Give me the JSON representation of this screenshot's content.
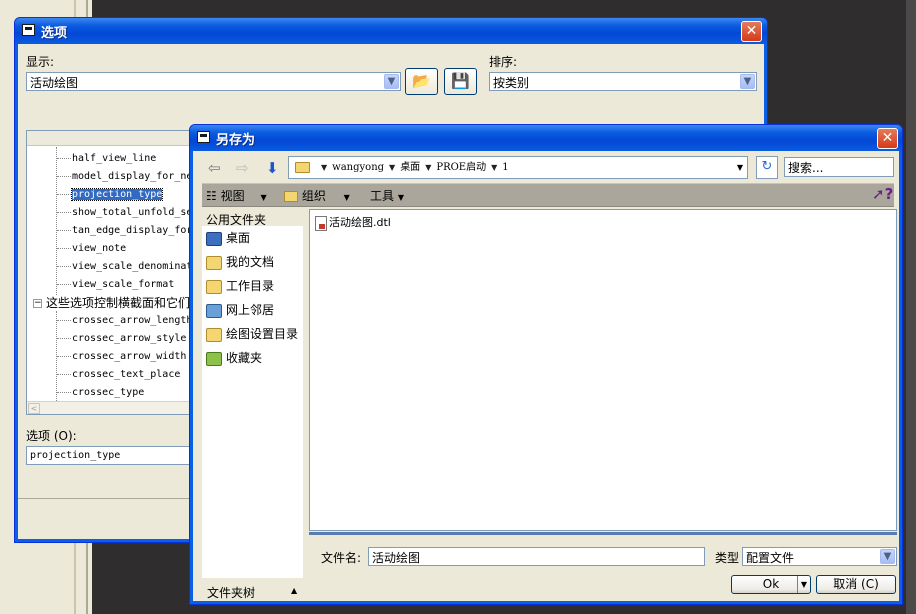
{
  "options_window": {
    "title": "选项",
    "close_glyph": "✕",
    "show_label": "显示:",
    "show_value": "活动绘图",
    "sort_label": "排序:",
    "sort_value": "按类别",
    "tree_items": [
      "half_view_line",
      "model_display_for_ne",
      "projection_type",
      "show_total_unfold_se",
      "tan_edge_display_for",
      "view_note",
      "view_scale_denominat",
      "view_scale_format"
    ],
    "selected_item": "projection_type",
    "group_label": "这些选项控制横截面和它们",
    "group_expander": "⊟",
    "group_items": [
      "crossec_arrow_length",
      "crossec_arrow_style",
      "crossec_arrow_width",
      "crossec_text_place",
      "crossec_type"
    ],
    "option_label": "选项 (O):",
    "option_value": "projection_type"
  },
  "save_window": {
    "title": "另存为",
    "close_glyph": "✕",
    "address_segments": [
      "wangyong",
      "桌面",
      "PROE启动",
      "1"
    ],
    "search_placeholder": "搜索...",
    "toolbar": {
      "view": "视图",
      "organize": "组织",
      "tools": "工具"
    },
    "sidebar_heading": "公用文件夹",
    "sidebar_items": [
      "桌面",
      "我的文档",
      "工作目录",
      "网上邻居",
      "绘图设置目录",
      "收藏夹"
    ],
    "files": [
      "活动绘图.dtl"
    ],
    "filename_label": "文件名:",
    "filename_value": "活动绘图",
    "type_label": "类型",
    "type_value": "配置文件",
    "ok_label": "Ok",
    "cancel_label": "取消 (C)",
    "folder_tree_label": "文件夹树"
  },
  "colors": {
    "title_bar": "#0a5cdf",
    "window_bg": "#ece9d8",
    "selection": "#316ac5",
    "close_button": "#d43a17"
  }
}
